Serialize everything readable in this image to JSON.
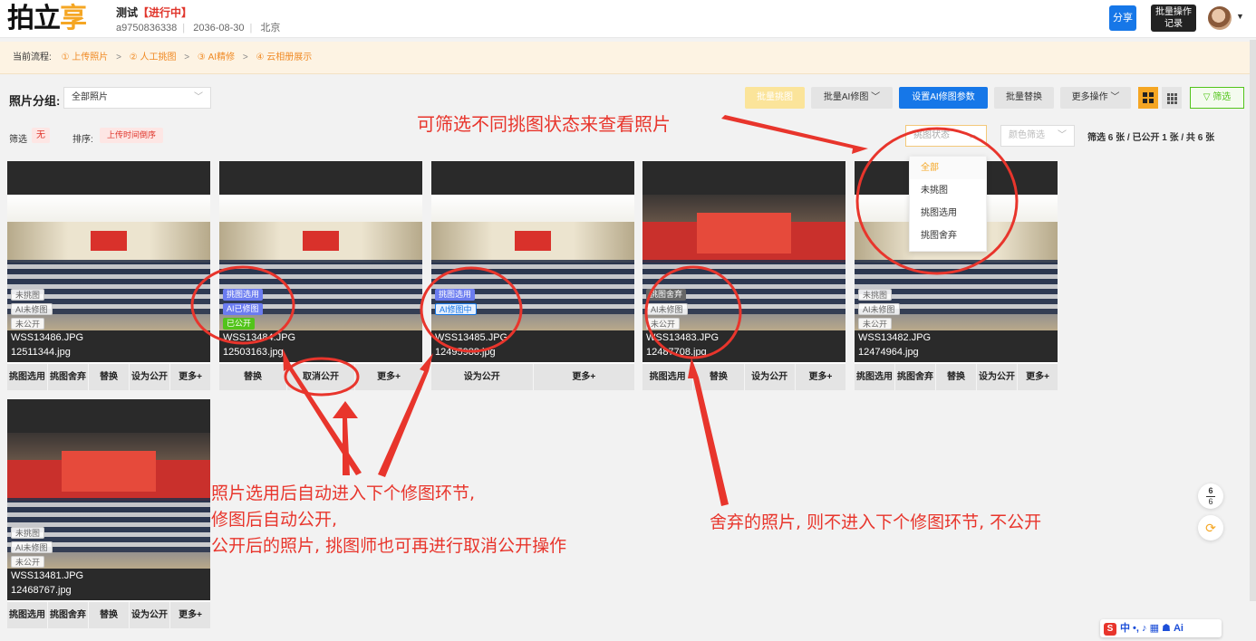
{
  "header": {
    "logo_a": "拍立",
    "logo_b": "享",
    "project_name": "测试",
    "status": "【进行中】",
    "project_id": "a9750836338",
    "date": "2036-08-30",
    "location": "北京",
    "share_label": "分享",
    "batch_record_line1": "批量操作",
    "batch_record_line2": "记录"
  },
  "workflow": {
    "label": "当前流程:",
    "steps": [
      "① 上传照片",
      "② 人工挑图",
      "③ AI精修",
      "④ 云相册展示"
    ],
    "arrow": ">"
  },
  "toolbar": {
    "group_label": "照片分组:",
    "group_value": "全部照片",
    "batch_pick": "批量挑图",
    "batch_ai": "批量AI修图",
    "set_ai_params": "设置AI修图参数",
    "batch_replace": "批量替换",
    "more_ops": "更多操作",
    "filter": "▽ 筛选"
  },
  "filterbar": {
    "filter_label": "筛选",
    "filter_value": "无",
    "sort_label": "排序:",
    "sort_value": "上传时间倒序",
    "status_placeholder": "挑图状态",
    "color_placeholder": "颜色筛选",
    "counts_prefix": "筛选",
    "filtered": "6",
    "unit1": "张 / 已公开",
    "public": "1",
    "unit2": "张 / 共",
    "total": "6",
    "unit3": "张"
  },
  "dropdown": {
    "items": [
      "全部",
      "未挑图",
      "挑图选用",
      "挑图舍弃"
    ],
    "selected": "全部"
  },
  "cards": [
    {
      "badges": [
        "未挑图",
        "AI未修图",
        "未公开"
      ],
      "name1": "WSS13486.JPG",
      "name2": "12511344.jpg",
      "actions": [
        "挑图选用",
        "挑图舍弃",
        "替换",
        "设为公开",
        "更多+"
      ]
    },
    {
      "badges": [
        "挑图选用",
        "AI已修图",
        "已公开"
      ],
      "name1": "WSS13484.JPG",
      "name2": "12503163.jpg",
      "actions": [
        "替换",
        "取消公开",
        "更多+"
      ]
    },
    {
      "badges": [
        "挑图选用",
        "AI修图中"
      ],
      "name1": "WSS13485.JPG",
      "name2": "12495988.jpg",
      "actions": [
        "设为公开",
        "更多+"
      ]
    },
    {
      "badges": [
        "挑图舍弃",
        "AI未修图",
        "未公开"
      ],
      "name1": "WSS13483.JPG",
      "name2": "12487708.jpg",
      "actions": [
        "挑图选用",
        "替换",
        "设为公开",
        "更多+"
      ]
    },
    {
      "badges": [
        "未挑图",
        "AI未修图",
        "未公开"
      ],
      "name1": "WSS13482.JPG",
      "name2": "12474964.jpg",
      "actions": [
        "挑图选用",
        "挑图舍弃",
        "替换",
        "设为公开",
        "更多+"
      ]
    },
    {
      "badges": [
        "未挑图",
        "AI未修图",
        "未公开"
      ],
      "name1": "WSS13481.JPG",
      "name2": "12468767.jpg",
      "actions": [
        "挑图选用",
        "挑图舍弃",
        "替换",
        "设为公开",
        "更多+"
      ]
    }
  ],
  "annotations": {
    "top": "可筛选不同挑图状态来查看照片",
    "left_l1": "照片选用后自动进入下个修图环节,",
    "left_l2": "修图后自动公开,",
    "left_l3": "公开后的照片, 挑图师也可再进行取消公开操作",
    "right": "舍弃的照片, 则不进入下个修图环节, 不公开"
  },
  "pager": {
    "current": "6",
    "total": "6"
  },
  "ime": {
    "text": "中 •, ♪ ▦ ☗ Ai"
  },
  "colors": {
    "accent": "#f5a623",
    "primary": "#1677e8",
    "annotation": "#e8352c",
    "success": "#52c41a"
  }
}
